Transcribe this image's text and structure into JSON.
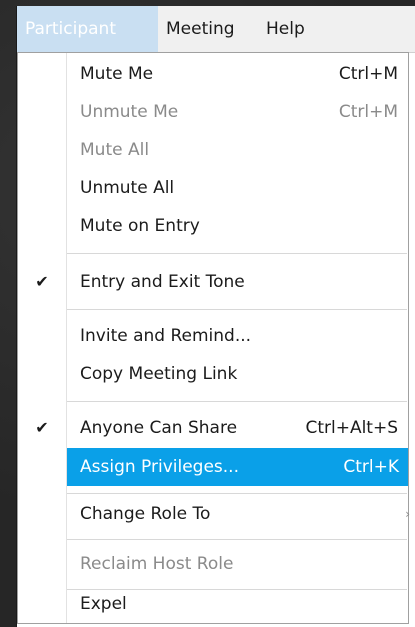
{
  "menubar": {
    "items": [
      {
        "label": "Participant"
      },
      {
        "label": "Meeting"
      },
      {
        "label": "Help"
      }
    ]
  },
  "menu": {
    "items": [
      {
        "label": "Mute Me",
        "shortcut": "Ctrl+M",
        "checked": false,
        "disabled": false
      },
      {
        "label": "Unmute Me",
        "shortcut": "Ctrl+M",
        "checked": false,
        "disabled": true
      },
      {
        "label": "Mute All",
        "shortcut": "",
        "checked": false,
        "disabled": true
      },
      {
        "label": "Unmute All",
        "shortcut": "",
        "checked": false,
        "disabled": false
      },
      {
        "label": "Mute on Entry",
        "shortcut": "",
        "checked": false,
        "disabled": false
      },
      {
        "label": "Entry and Exit Tone",
        "shortcut": "",
        "checked": true,
        "disabled": false
      },
      {
        "label": "Invite and Remind...",
        "shortcut": "",
        "checked": false,
        "disabled": false
      },
      {
        "label": "Copy Meeting Link",
        "shortcut": "",
        "checked": false,
        "disabled": false
      },
      {
        "label": "Anyone Can Share",
        "shortcut": "Ctrl+Alt+S",
        "checked": true,
        "disabled": false
      },
      {
        "label": "Assign Privileges...",
        "shortcut": "Ctrl+K",
        "checked": false,
        "disabled": false,
        "highlighted": true
      },
      {
        "label": "Change Role To",
        "shortcut": "",
        "checked": false,
        "disabled": false,
        "submenu": true
      },
      {
        "label": "Reclaim Host Role",
        "shortcut": "",
        "checked": false,
        "disabled": true
      },
      {
        "label": "Expel",
        "shortcut": "",
        "checked": false,
        "disabled": false
      }
    ],
    "check_glyph": "✔"
  },
  "colors": {
    "highlight": "#0aa0e8",
    "active_menubar": "#c9dff2",
    "disabled_text": "#8a8a8a"
  }
}
